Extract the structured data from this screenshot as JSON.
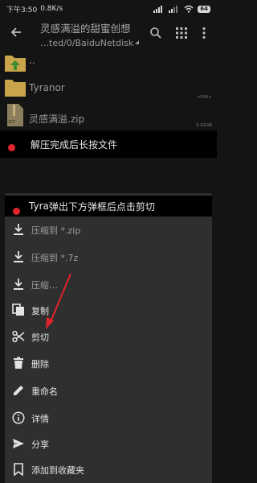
{
  "status": {
    "time": "下午3:50",
    "speed": "0.8K/s",
    "battery": "64"
  },
  "appbar": {
    "title": "灵感满溢的甜蜜创想",
    "subtitle": "…ted/0/BaiduNetdisk"
  },
  "files": [
    {
      "name": "..",
      "meta": ""
    },
    {
      "name": "Tyranor",
      "meta": "<DIR>"
    },
    {
      "name": "灵感满溢.zip",
      "meta": "3.41GB",
      "icon_label": "ZIP"
    }
  ],
  "callouts": {
    "first": "解压完成后长按文件",
    "second_prefix": "Tyra",
    "second": "弹出下方弹框后点击剪切"
  },
  "menu": [
    {
      "label": "压缩到 *.zip",
      "icon": "download-icon"
    },
    {
      "label": "压缩到 *.7z",
      "icon": "download-icon"
    },
    {
      "label": "压缩…",
      "icon": "download-icon"
    },
    {
      "label": "复制",
      "icon": "copy-icon"
    },
    {
      "label": "剪切",
      "icon": "scissors-icon"
    },
    {
      "label": "删除",
      "icon": "trash-icon"
    },
    {
      "label": "重命名",
      "icon": "pencil-icon"
    },
    {
      "label": "详情",
      "icon": "info-icon"
    },
    {
      "label": "分享",
      "icon": "share-icon"
    },
    {
      "label": "添加到收藏夹",
      "icon": "bookmark-icon"
    }
  ],
  "colors": {
    "annotation": "#e0242b",
    "folder": "#caa44a",
    "sheet": "#2f2f2f"
  }
}
